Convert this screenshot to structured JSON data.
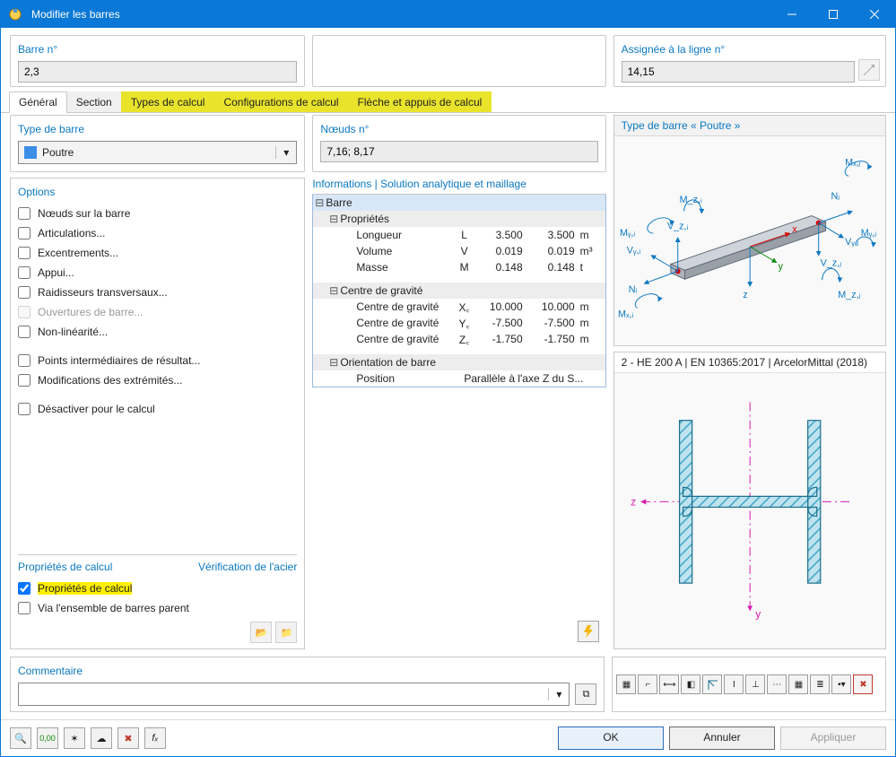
{
  "window": {
    "title": "Modifier les barres"
  },
  "header": {
    "barre_no_label": "Barre n°",
    "barre_no_value": "2,3",
    "assign_label": "Assignée à la ligne n°",
    "assign_value": "14,15"
  },
  "tabs": [
    {
      "id": "general",
      "label": "Général",
      "active": true,
      "hl": false
    },
    {
      "id": "section",
      "label": "Section",
      "active": false,
      "hl": false
    },
    {
      "id": "types",
      "label": "Types de calcul",
      "active": false,
      "hl": true
    },
    {
      "id": "configs",
      "label": "Configurations de calcul",
      "active": false,
      "hl": true
    },
    {
      "id": "fleche",
      "label": "Flèche et appuis de calcul",
      "active": false,
      "hl": true
    }
  ],
  "left": {
    "type_label": "Type de barre",
    "type_value": "Poutre",
    "options_label": "Options",
    "options": [
      {
        "key": "noeuds",
        "label": "Nœuds sur la barre",
        "enabled": true
      },
      {
        "key": "artic",
        "label": "Articulations...",
        "enabled": true
      },
      {
        "key": "excentr",
        "label": "Excentrements...",
        "enabled": true
      },
      {
        "key": "appui",
        "label": "Appui...",
        "enabled": true
      },
      {
        "key": "raid",
        "label": "Raidisseurs transversaux...",
        "enabled": true
      },
      {
        "key": "ouv",
        "label": "Ouvertures de barre...",
        "enabled": false
      },
      {
        "key": "nonlin",
        "label": "Non-linéarité...",
        "enabled": true
      },
      {
        "key": "ptint",
        "label": "Points intermédiaires de résultat...",
        "enabled": true
      },
      {
        "key": "modext",
        "label": "Modifications des extrémités...",
        "enabled": true
      },
      {
        "key": "deact",
        "label": "Désactiver pour le calcul",
        "enabled": true
      }
    ],
    "props": {
      "title_left": "Propriétés de calcul",
      "title_right": "Vérification de l'acier",
      "chk1": "Propriétés de calcul",
      "chk2": "Via l'ensemble de barres parent"
    }
  },
  "middle": {
    "noeuds_label": "Nœuds n°",
    "noeuds_value": "7,16; 8,17",
    "info_header": "Informations | Solution analytique et maillage",
    "rows": {
      "barre": "Barre",
      "proprietes": "Propriétés",
      "longueur": "Longueur",
      "volume": "Volume",
      "masse": "Masse",
      "cog": "Centre de gravité",
      "cogx": "Centre de gravité",
      "cogy": "Centre de gravité",
      "cogz": "Centre de gravité",
      "orient": "Orientation de barre",
      "position": "Position",
      "position_val": "Parallèle à l'axe Z du S..."
    },
    "vals": {
      "L": {
        "s": "L",
        "v1": "3.500",
        "v2": "3.500",
        "u": "m"
      },
      "V": {
        "s": "V",
        "v1": "0.019",
        "v2": "0.019",
        "u": "m³"
      },
      "M": {
        "s": "M",
        "v1": "0.148",
        "v2": "0.148",
        "u": "t"
      },
      "Xc": {
        "s": "X꜀",
        "v1": "10.000",
        "v2": "10.000",
        "u": "m"
      },
      "Yc": {
        "s": "Y꜀",
        "v1": "-7.500",
        "v2": "-7.500",
        "u": "m"
      },
      "Zc": {
        "s": "Z꜀",
        "v1": "-1.750",
        "v2": "-1.750",
        "u": "m"
      }
    }
  },
  "right": {
    "top_header": "Type de barre « Poutre »",
    "section_title": "2 - HE 200 A | EN 10365:2017 | ArcelorMittal (2018)",
    "beam_labels": {
      "Ni": "Nᵢ",
      "Nj": "Nⱼ",
      "Mxi": "Mₓ,ᵢ",
      "Mxj": "Mₓ,ⱼ",
      "Myi": "Mᵧ,ᵢ",
      "Myj": "Mᵧ,ⱼ",
      "Mzi": "M_z,ᵢ",
      "Mzj": "M_z,ⱼ",
      "Vyi": "Vᵧ,ᵢ",
      "Vyj": "Vᵧ,ⱼ",
      "Vzi": "V_z,ᵢ",
      "Vzj": "V_z,ⱼ",
      "x": "x",
      "y": "y",
      "z": "z"
    },
    "axes": {
      "y": "y",
      "z": "z"
    }
  },
  "comment_label": "Commentaire",
  "buttons": {
    "ok": "OK",
    "cancel": "Annuler",
    "apply": "Appliquer"
  }
}
